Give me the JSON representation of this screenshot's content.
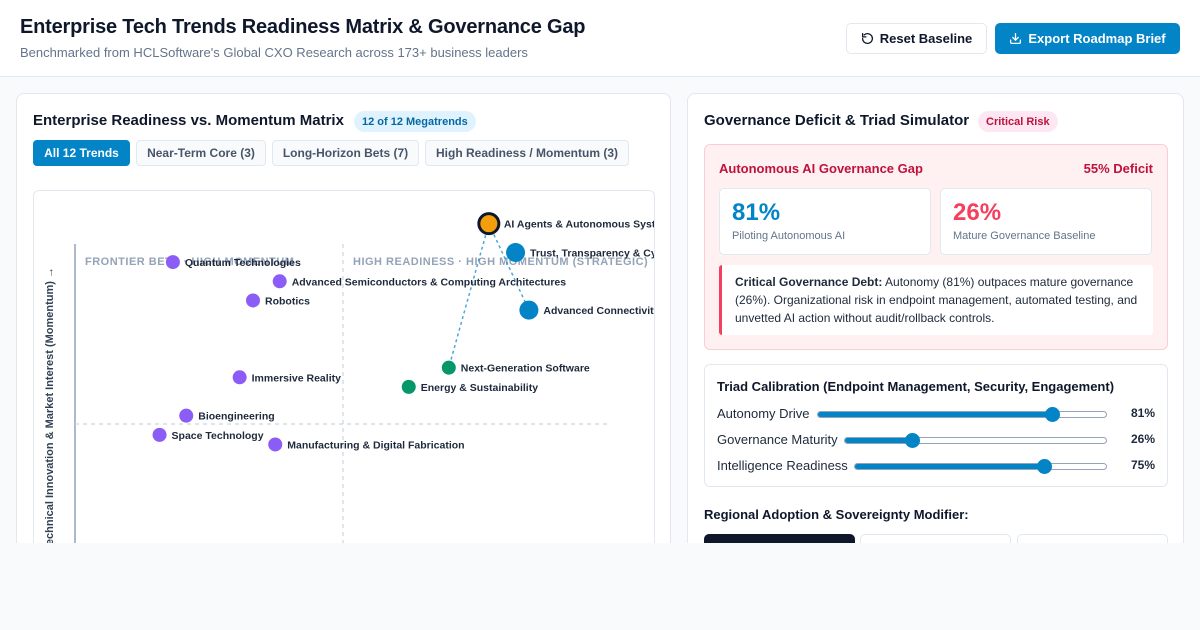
{
  "header": {
    "title": "Enterprise Tech Trends Readiness Matrix & Governance Gap",
    "subtitle": "Benchmarked from HCLSoftware's Global CXO Research across 173+ business leaders",
    "reset_label": "Reset Baseline",
    "export_label": "Export Roadmap Brief"
  },
  "matrix": {
    "title": "Enterprise Readiness vs. Momentum Matrix",
    "count_badge": "12 of 12 Megatrends",
    "filters": [
      {
        "label": "All 12 Trends",
        "active": true
      },
      {
        "label": "Near-Term Core (3)",
        "active": false
      },
      {
        "label": "Long-Horizon Bets (7)",
        "active": false
      },
      {
        "label": "High Readiness / Momentum (3)",
        "active": false
      }
    ]
  },
  "chart_data": {
    "type": "scatter",
    "ylabel": "Technical Innovation & Market Interest (Momentum) →",
    "quadrants": {
      "top_left": "FRONTIER BETS · HIGH MOMENTUM",
      "top_right": "HIGH READINESS · HIGH MOMENTUM (STRATEGIC)"
    },
    "colors": {
      "purple": "#8b5cf6",
      "blue": "#0284c7",
      "green": "#059669",
      "orange": "#f59e0b"
    },
    "points": [
      {
        "label": "AI Agents & Autonomous Systems",
        "x": 7.15,
        "y": 8.9,
        "color": "orange",
        "highlight": true,
        "size": "xl"
      },
      {
        "label": "Trust, Transparency & Cybersecurity",
        "x": 7.45,
        "y": 8.45,
        "color": "blue",
        "size": "lg"
      },
      {
        "label": "Advanced Semiconductors & Computing Architectures",
        "x": 4.8,
        "y": 8.0,
        "color": "purple",
        "size": "sm"
      },
      {
        "label": "Quantum Technologies",
        "x": 3.6,
        "y": 8.3,
        "color": "purple",
        "size": "sm"
      },
      {
        "label": "Robotics",
        "x": 4.5,
        "y": 7.7,
        "color": "purple",
        "size": "sm"
      },
      {
        "label": "Advanced Connectivity",
        "x": 7.6,
        "y": 7.55,
        "color": "blue",
        "size": "lg"
      },
      {
        "label": "Immersive Reality",
        "x": 4.35,
        "y": 6.5,
        "color": "purple",
        "size": "sm"
      },
      {
        "label": "Next-Generation Software",
        "x": 6.7,
        "y": 6.65,
        "color": "green",
        "size": "sm"
      },
      {
        "label": "Energy & Sustainability",
        "x": 6.25,
        "y": 6.35,
        "color": "green",
        "size": "sm"
      },
      {
        "label": "Bioengineering",
        "x": 3.75,
        "y": 5.9,
        "color": "purple",
        "size": "sm"
      },
      {
        "label": "Space Technology",
        "x": 3.45,
        "y": 5.6,
        "color": "purple",
        "size": "sm"
      },
      {
        "label": "Manufacturing & Digital Fabrication",
        "x": 4.75,
        "y": 5.45,
        "color": "purple",
        "size": "sm"
      }
    ],
    "links": [
      [
        "AI Agents & Autonomous Systems",
        "Next-Generation Software"
      ],
      [
        "AI Agents & Autonomous Systems",
        "Advanced Connectivity"
      ]
    ]
  },
  "governance": {
    "title": "Governance Deficit & Triad Simulator",
    "risk_badge": "Critical Risk",
    "gap_title": "Autonomous AI Governance Gap",
    "deficit": "55% Deficit",
    "stat_piloting": {
      "value": "81%",
      "label": "Piloting Autonomous AI",
      "color": "#0284c7"
    },
    "stat_mature": {
      "value": "26%",
      "label": "Mature Governance Baseline",
      "color": "#f43f5e"
    },
    "debt_label": "Critical Governance Debt:",
    "debt_text": " Autonomy (81%) outpaces mature governance (26%). Organizational risk in endpoint management, automated testing, and unvetted AI action without audit/rollback controls."
  },
  "triad": {
    "title": "Triad Calibration (Endpoint Management, Security, Engagement)",
    "sliders": [
      {
        "label": "Autonomy Drive",
        "value": 81,
        "display": "81%"
      },
      {
        "label": "Governance Maturity",
        "value": 26,
        "display": "26%"
      },
      {
        "label": "Intelligence Readiness",
        "value": 75,
        "display": "75%"
      }
    ]
  },
  "region": {
    "title": "Regional Adoption & Sovereignty Modifier:"
  }
}
